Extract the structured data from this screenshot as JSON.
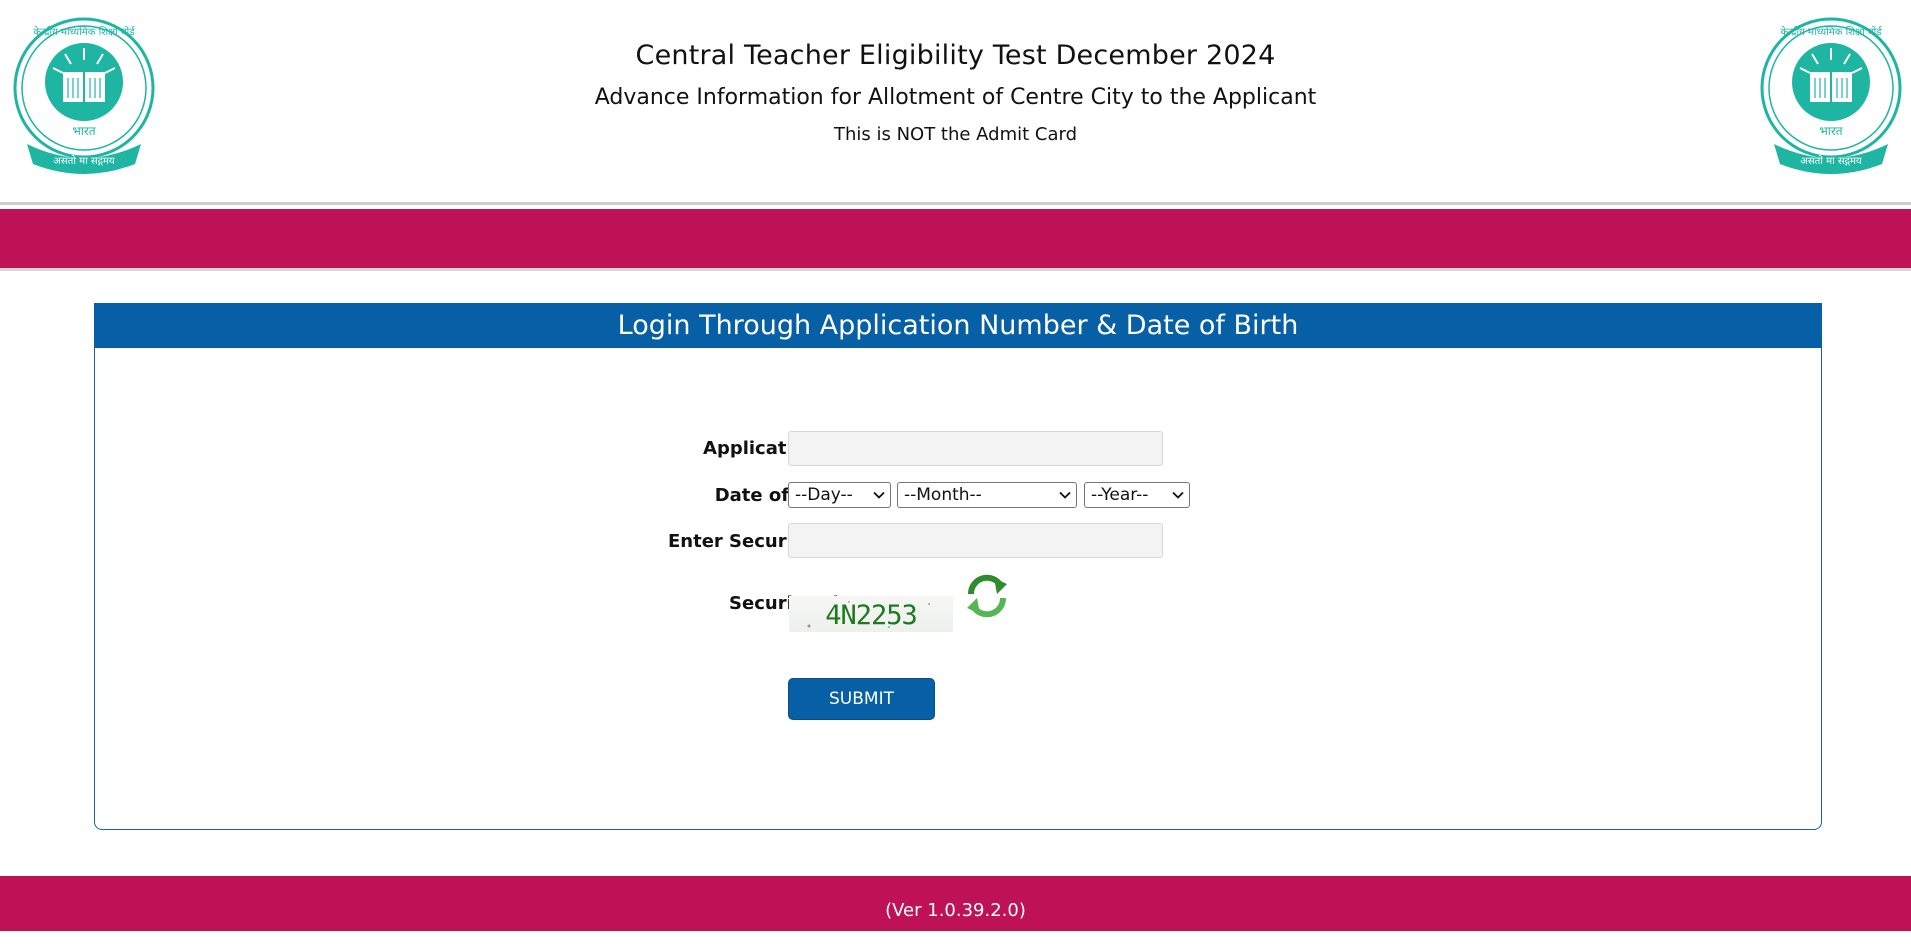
{
  "header": {
    "title": "Central Teacher Eligibility Test December 2024",
    "subtitle": "Advance Information for Allotment of Centre City to the Applicant",
    "note": "This is NOT the Admit Card",
    "logo_left_icon": "cbse-emblem-icon",
    "logo_right_icon": "cbse-emblem-icon",
    "logo_top_text": "केन्द्रीय माध्यमिक शिक्षा बोर्ड",
    "logo_bottom_text": "असतो मा सद्गमय",
    "logo_center_text": "भारत"
  },
  "login": {
    "heading": "Login Through Application Number & Date of Birth",
    "application_label": "Application No :",
    "application_value": "",
    "dob_label": "Date of Birth :",
    "day_selected": "--Day--",
    "month_selected": "--Month--",
    "year_selected": "--Year--",
    "security_pin_label": "Enter Security Pin :",
    "security_pin_value": "",
    "captcha_label": "Security Pin :",
    "captcha_text": "4N2253",
    "refresh_icon": "refresh-icon",
    "submit_label": "SUBMIT"
  },
  "footer": {
    "version": "(Ver 1.0.39.2.0)"
  },
  "colors": {
    "primary_blue": "#0760a6",
    "magenta": "#bf1155",
    "emblem_teal": "#1fb5a3"
  }
}
